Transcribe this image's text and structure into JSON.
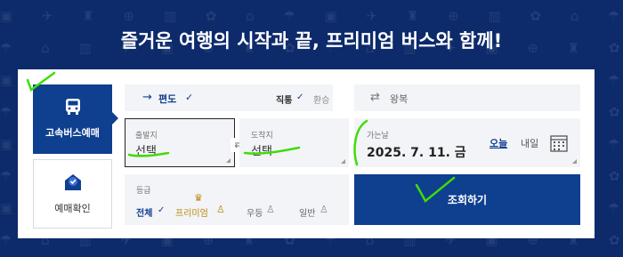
{
  "headline": "즐거운 여행의 시작과 끝, 프리미엄 버스와 함께!",
  "tabs": {
    "bus_booking": "고속버스예매",
    "booking_check": "예매확인"
  },
  "trip": {
    "arrow": "→",
    "one_way_label": "편도",
    "one_way_check": "✓",
    "direct_label": "직통",
    "direct_check": "✓",
    "transfer_label": "환승",
    "swap_symbol": "⇄",
    "round_trip_label": "왕복"
  },
  "route": {
    "departure_label": "출발지",
    "departure_value": "선택",
    "arrival_label": "도착지",
    "arrival_value": "선택",
    "swap_symbol": "⇄"
  },
  "date": {
    "label": "가는날",
    "value": "2025. 7. 11. 금",
    "today_button": "오늘",
    "tomorrow_button": "내일"
  },
  "grade": {
    "label": "등급",
    "all_label": "전체",
    "all_check": "✓",
    "premium_label": "프리미엄",
    "premium_icon": "crown-icon",
    "superior_label": "우등",
    "normal_label": "일반"
  },
  "search_button": "조회하기",
  "colors": {
    "background": "#0d2a6b",
    "accent": "#0f3f8f",
    "premium": "#b8860b",
    "annotation": "#3fdc0a"
  }
}
